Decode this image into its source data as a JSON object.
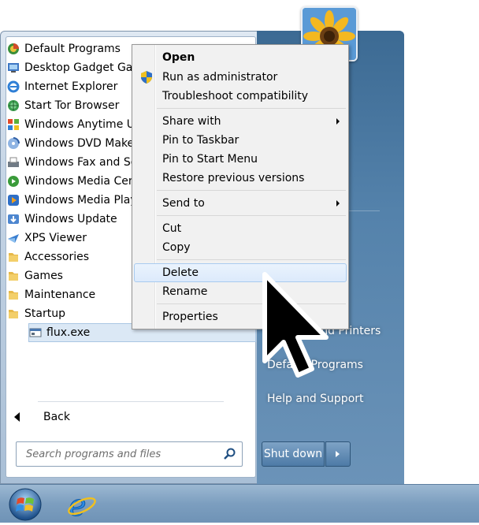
{
  "programs": [
    {
      "label": "Default Programs",
      "icon": "default-programs-icon"
    },
    {
      "label": "Desktop Gadget Gallery",
      "icon": "gadget-gallery-icon"
    },
    {
      "label": "Internet Explorer",
      "icon": "internet-explorer-icon"
    },
    {
      "label": "Start Tor Browser",
      "icon": "tor-browser-icon"
    },
    {
      "label": "Windows Anytime Upgrade",
      "icon": "anytime-upgrade-icon"
    },
    {
      "label": "Windows DVD Maker",
      "icon": "dvd-maker-icon"
    },
    {
      "label": "Windows Fax and Scan",
      "icon": "fax-scan-icon"
    },
    {
      "label": "Windows Media Center",
      "icon": "media-center-icon"
    },
    {
      "label": "Windows Media Player",
      "icon": "media-player-icon"
    },
    {
      "label": "Windows Update",
      "icon": "windows-update-icon"
    },
    {
      "label": "XPS Viewer",
      "icon": "xps-viewer-icon"
    },
    {
      "label": "Accessories",
      "icon": "folder-icon"
    },
    {
      "label": "Games",
      "icon": "folder-icon"
    },
    {
      "label": "Maintenance",
      "icon": "folder-icon"
    },
    {
      "label": "Startup",
      "icon": "folder-icon"
    }
  ],
  "selected_item": {
    "label": "flux.exe",
    "icon": "exe-file-icon"
  },
  "back_label": "Back",
  "search": {
    "placeholder": "Search programs and files"
  },
  "right_pane": {
    "devices": "Devices and Printers",
    "default_programs": "Default Programs",
    "help": "Help and Support"
  },
  "shutdown_label": "Shut down",
  "context_menu": {
    "open": "Open",
    "run_as_admin": "Run as administrator",
    "troubleshoot": "Troubleshoot compatibility",
    "share_with": "Share with",
    "pin_taskbar": "Pin to Taskbar",
    "pin_start": "Pin to Start Menu",
    "restore": "Restore previous versions",
    "send_to": "Send to",
    "cut": "Cut",
    "copy": "Copy",
    "delete": "Delete",
    "rename": "Rename",
    "properties": "Properties"
  },
  "colors": {
    "right_pane": "#4a78a2",
    "highlight": "#dceafb",
    "taskbar": "#7c9ebf"
  }
}
